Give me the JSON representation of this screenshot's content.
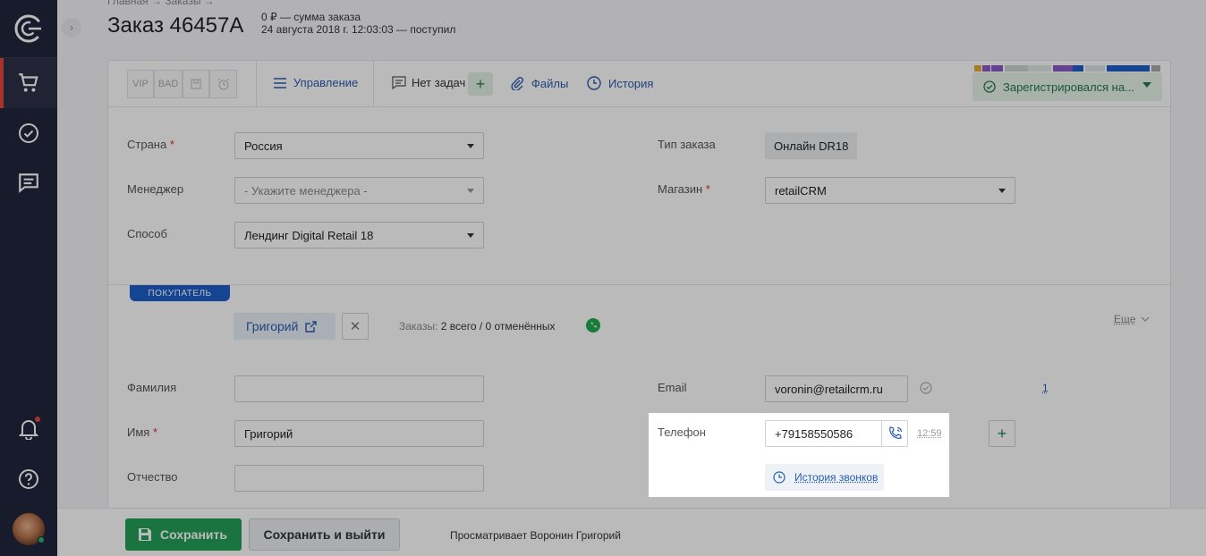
{
  "header": {
    "breadcrumb": "Главная → Заказы →",
    "title": "Заказ 46457А",
    "sum": "0 ₽ — сумма заказа",
    "date": "24 августа 2018 г. 12:03:03 — поступил"
  },
  "toolbar": {
    "tags": [
      "VIP",
      "BAD"
    ],
    "manage": "Управление",
    "tasks": "Нет задач",
    "files": "Файлы",
    "history": "История",
    "status": "Зарегистрировался на..."
  },
  "order_fields": {
    "country_label": "Страна",
    "country_value": "Россия",
    "manager_label": "Менеджер",
    "manager_placeholder": "- Укажите менеджера -",
    "method_label": "Способ",
    "method_value": "Лендинг Digital Retail 18",
    "order_type_label": "Тип заказа",
    "order_type_value": "Онлайн DR18",
    "shop_label": "Магазин",
    "shop_value": "retailCRM"
  },
  "customer": {
    "section_tag": "ПОКУПАТЕЛЬ",
    "name_chip": "Григорий",
    "orders_prefix": "Заказы:",
    "orders_count": "2 всего / 0 отменённых",
    "more": "Еще",
    "lastname_label": "Фамилия",
    "lastname_value": "",
    "firstname_label": "Имя",
    "firstname_value": "Григорий",
    "patronymic_label": "Отчество",
    "patronymic_value": "",
    "email_label": "Email",
    "email_value": "voronin@retailcrm.ru",
    "email_count": "1",
    "phone_label": "Телефон",
    "phone_value": "+79158550586",
    "phone_time": "12:59",
    "call_history": "История звонков"
  },
  "footer": {
    "save": "Сохранить",
    "save_exit": "Сохранить и выйти",
    "viewer": "Просматривает Воронин Григорий"
  },
  "colors": {
    "sidebar": "#22253c",
    "accent_red": "#e4473d",
    "primary_green": "#239f57",
    "link_blue": "#2a5dad",
    "section_blue": "#1e5ec8"
  }
}
